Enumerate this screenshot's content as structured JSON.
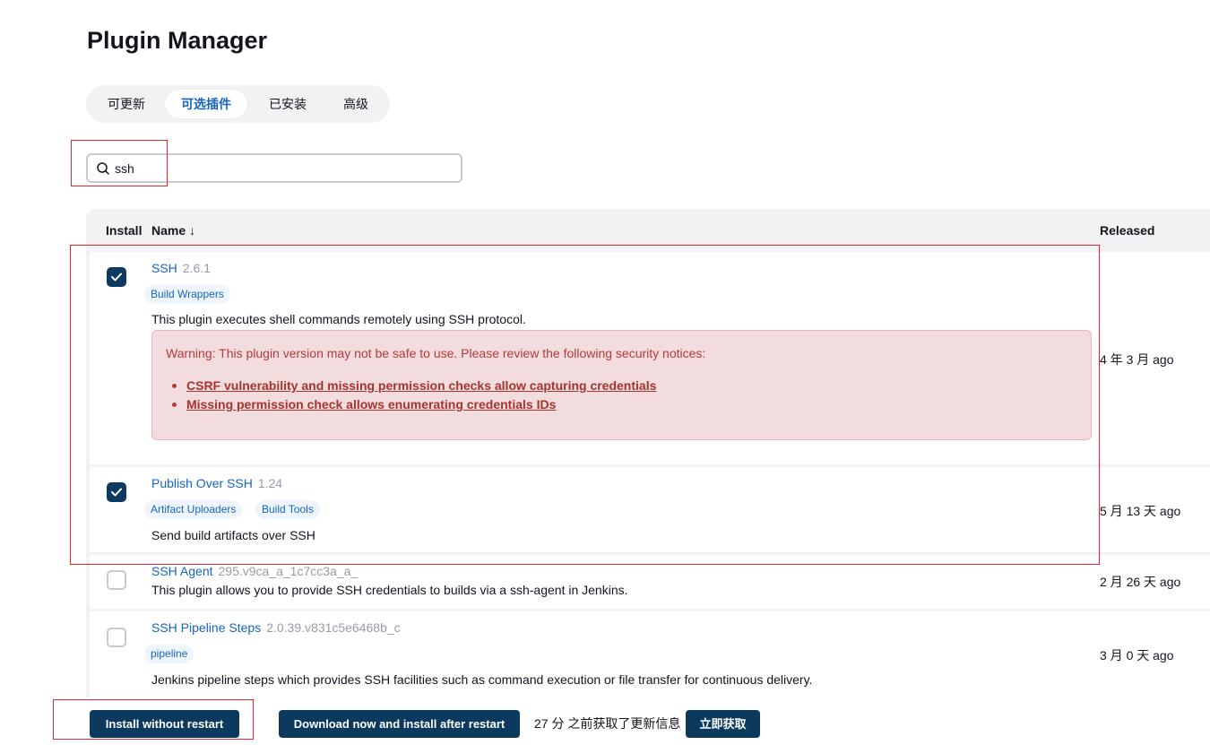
{
  "page": {
    "title": "Plugin Manager"
  },
  "tabs": [
    {
      "label": "可更新",
      "active": false
    },
    {
      "label": "可选插件",
      "active": true
    },
    {
      "label": "已安装",
      "active": false
    },
    {
      "label": "高级",
      "active": false
    }
  ],
  "search": {
    "value": "ssh",
    "placeholder": "",
    "icon": "search-icon"
  },
  "table": {
    "headers": {
      "install": "Install",
      "name": "Name ↓",
      "released": "Released"
    },
    "rows": [
      {
        "name": "SSH",
        "version": "2.6.1",
        "checked": true,
        "tags": [
          "Build Wrappers"
        ],
        "description": "This plugin executes shell commands remotely using SSH protocol.",
        "warning": {
          "title": "Warning: This plugin version may not be safe to use. Please review the following security notices:",
          "links": [
            "CSRF vulnerability and missing permission checks allow capturing credentials",
            "Missing permission check allows enumerating credentials IDs"
          ]
        },
        "released": "4 年 3 月 ago"
      },
      {
        "name": "Publish Over SSH",
        "version": "1.24",
        "checked": true,
        "tags": [
          "Artifact Uploaders",
          "Build Tools"
        ],
        "description": "Send build artifacts over SSH",
        "released": "5 月 13 天 ago"
      },
      {
        "name": "SSH Agent",
        "version": "295.v9ca_a_1c7cc3a_a_",
        "checked": false,
        "tags": [],
        "description": "This plugin allows you to provide SSH credentials to builds via a ssh-agent in Jenkins.",
        "released": "2 月 26 天 ago"
      },
      {
        "name": "SSH Pipeline Steps",
        "version": "2.0.39.v831c5e6468b_c",
        "checked": false,
        "tags": [
          "pipeline"
        ],
        "description": "Jenkins pipeline steps which provides SSH facilities such as command execution or file transfer for continuous delivery.",
        "released": "3 月 0 天 ago"
      }
    ]
  },
  "footer": {
    "install_without_restart": "Install without restart",
    "download_and_install": "Download now and install after restart",
    "status_text": "27 分 之前获取了更新信息",
    "fetch_now": "立即获取"
  },
  "colors": {
    "accent": "#1565c0",
    "primary_button": "#0b3a5e",
    "highlight": "#e0262e",
    "warning_bg": "#f3dcdd"
  }
}
